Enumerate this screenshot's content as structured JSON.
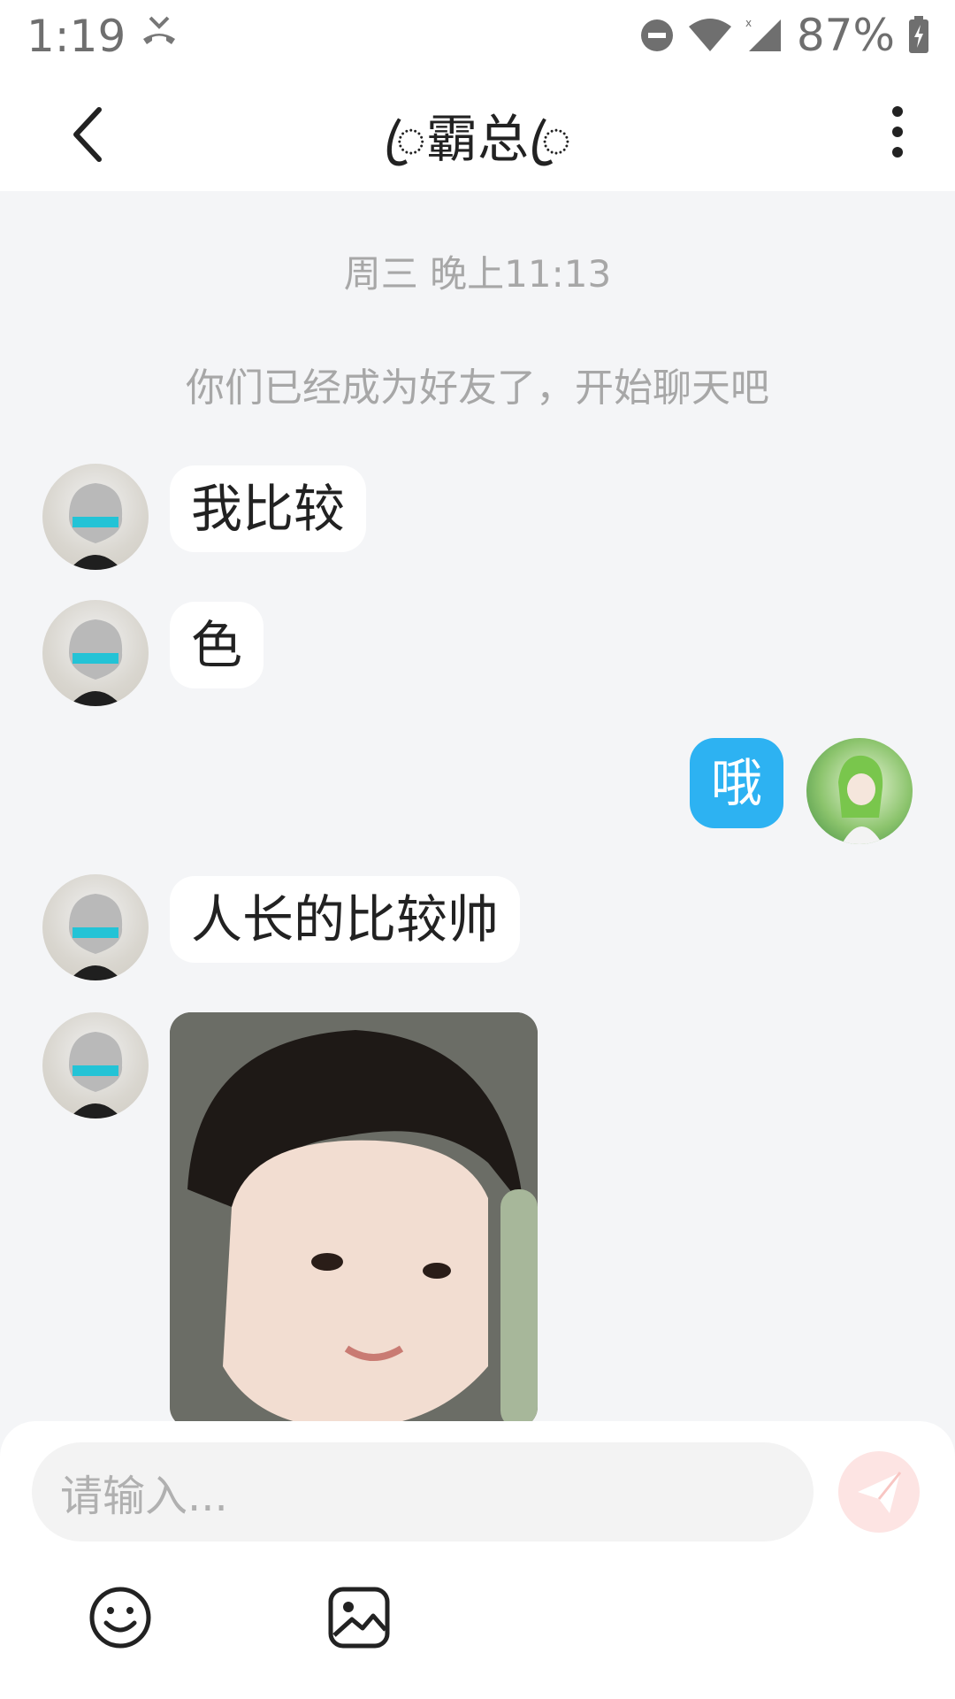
{
  "status_bar": {
    "time": "1:19",
    "battery": "87%",
    "icons": [
      "missed-call-icon",
      "do-not-disturb-icon",
      "wifi-icon",
      "signal-icon",
      "battery-charging-icon"
    ]
  },
  "header": {
    "title": "ꦿ霸总ꦿ",
    "back_icon": "chevron-left-icon",
    "more_icon": "more-vertical-icon"
  },
  "chat": {
    "timestamp": "周三 晚上11:13",
    "system_message": "你们已经成为好友了，开始聊天吧",
    "messages": [
      {
        "side": "other",
        "type": "text",
        "text": "我比较"
      },
      {
        "side": "other",
        "type": "text",
        "text": "色"
      },
      {
        "side": "me",
        "type": "text",
        "text": "哦"
      },
      {
        "side": "other",
        "type": "text",
        "text": "人长的比较帅"
      },
      {
        "side": "other",
        "type": "image"
      }
    ]
  },
  "composer": {
    "placeholder": "请输入...",
    "send_icon": "send-icon",
    "tools": [
      "emoji-icon",
      "image-icon"
    ]
  },
  "colors": {
    "accent_bubble": "#2db2f2",
    "background": "#f4f5f7",
    "send_button": "#fde4e3"
  }
}
